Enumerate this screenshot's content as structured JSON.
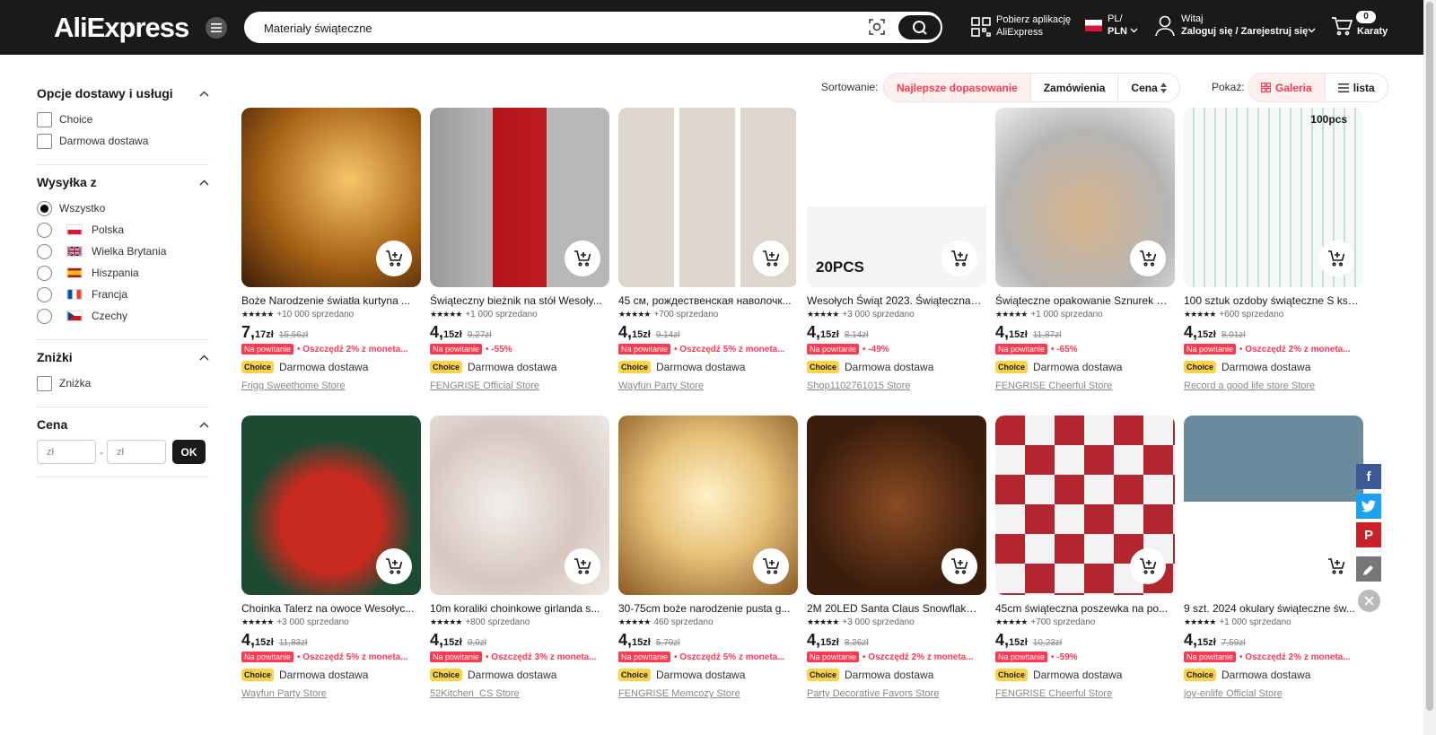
{
  "header": {
    "logo": "AliExpress",
    "search_value": "Materiały świąteczne",
    "app_line1": "Pobierz aplikację",
    "app_line2": "AliExpress",
    "lang_line1": "PL/",
    "lang_line2": "PLN",
    "user_line1": "Witaj",
    "user_line2": "Zaloguj się / Zarejestruj się",
    "cart_count": "0",
    "cart_label": "Karaty"
  },
  "filters": {
    "delivery": {
      "title": "Opcje dostawy i usługi",
      "options": [
        "Choice",
        "Darmowa dostawa"
      ]
    },
    "ship_from": {
      "title": "Wysyłka z",
      "options": [
        "Wszystko",
        "Polska",
        "Wielka Brytania",
        "Hiszpania",
        "Francja",
        "Czechy"
      ]
    },
    "discounts": {
      "title": "Zniżki",
      "options": [
        "Zniżka"
      ]
    },
    "price": {
      "title": "Cena",
      "min_placeholder": "zł",
      "max_placeholder": "zł",
      "ok_label": "OK"
    }
  },
  "sort": {
    "label": "Sortowanie:",
    "options": [
      "Najlepsze dopasowanie",
      "Zamówienia",
      "Cena"
    ],
    "view_label": "Pokaż:",
    "views": [
      "Galeria",
      "lista"
    ]
  },
  "common": {
    "new_tag": "Na powitanie",
    "choice": "Choice",
    "free_ship": "Darmowa dostawa"
  },
  "products": [
    {
      "title": "Boże Narodzenie światła kurtyna ...",
      "sold": "+10 000 sprzedano",
      "price_int": "7,",
      "price_dec": "17zł",
      "old": "15,56zł",
      "promo": "• Oszczędź 2% z moneta...",
      "store": "Frigg Sweethome Store"
    },
    {
      "title": "Świąteczny bieżnik na stół Wesoły...",
      "sold": "+1 000 sprzedano",
      "price_int": "4,",
      "price_dec": "15zł",
      "old": "9,27zł",
      "promo": "• -55%",
      "store": "FENGRISE Official Store"
    },
    {
      "title": "45 см, рождественская наволочк...",
      "sold": "+700 sprzedano",
      "price_int": "4,",
      "price_dec": "15zł",
      "old": "9,14zł",
      "promo": "• Oszczędź 5% z moneta...",
      "store": "Wayfun Party Store"
    },
    {
      "title": "Wesołych Świąt 2023. Świąteczna ...",
      "sold": "+3 000 sprzedano",
      "price_int": "4,",
      "price_dec": "15zł",
      "old": "8,14zł",
      "promo": "• -49%",
      "store": "Shop1102761015 Store"
    },
    {
      "title": "Świąteczne opakowanie Sznurek s...",
      "sold": "+1 000 sprzedano",
      "price_int": "4,",
      "price_dec": "15zł",
      "old": "11,87zł",
      "promo": "• -65%",
      "store": "FENGRISE Cheerful Store"
    },
    {
      "title": "100 sztuk ozdoby świąteczne S ksz...",
      "sold": "+600 sprzedano",
      "price_int": "4,",
      "price_dec": "15zł",
      "old": "8,01zł",
      "promo": "• Oszczędź 2% z moneta...",
      "store": "Record a good life store Store"
    },
    {
      "title": "Choinka Talerz na owoce Wesołyc...",
      "sold": "+3 000 sprzedano",
      "price_int": "4,",
      "price_dec": "15zł",
      "old": "11,83zł",
      "promo": "• Oszczędź 5% z moneta...",
      "store": "Wayfun Party Store"
    },
    {
      "title": "10m koraliki choinkowe girlanda s...",
      "sold": "+800 sprzedano",
      "price_int": "4,",
      "price_dec": "15zł",
      "old": "9,9zł",
      "promo": "• Oszczędź 3% z moneta...",
      "store": "52Kitchen_CS Store"
    },
    {
      "title": "30-75cm boże narodzenie pusta g...",
      "sold": "460 sprzedano",
      "price_int": "4,",
      "price_dec": "15zł",
      "old": "5,79zł",
      "promo": "• Oszczędź 5% z moneta...",
      "store": "FENGRISE Memcozy Store"
    },
    {
      "title": "2M 20LED Santa Claus Snowflake ...",
      "sold": "+3 000 sprzedano",
      "price_int": "4,",
      "price_dec": "15zł",
      "old": "8,26zł",
      "promo": "• Oszczędź 2% z moneta...",
      "store": "Party Decorative Favors Store"
    },
    {
      "title": "45cm świąteczna poszewka na po...",
      "sold": "+700 sprzedano",
      "price_int": "4,",
      "price_dec": "15zł",
      "old": "10,23zł",
      "promo": "• -59%",
      "store": "FENGRISE Cheerful Store"
    },
    {
      "title": "9 szt. 2024 okulary świąteczne św...",
      "sold": "+1 000 sprzedano",
      "price_int": "4,",
      "price_dec": "15zł",
      "old": "7,59zł",
      "promo": "• Oszczędź 2% z moneta...",
      "store": "joy-enlife Official Store"
    }
  ],
  "image_text": {
    "p4": "20PCS",
    "p6": "100pcs"
  },
  "colors": {
    "header": "#1a1a1a",
    "accent": "#fd384f",
    "choice": "#fcd348"
  }
}
